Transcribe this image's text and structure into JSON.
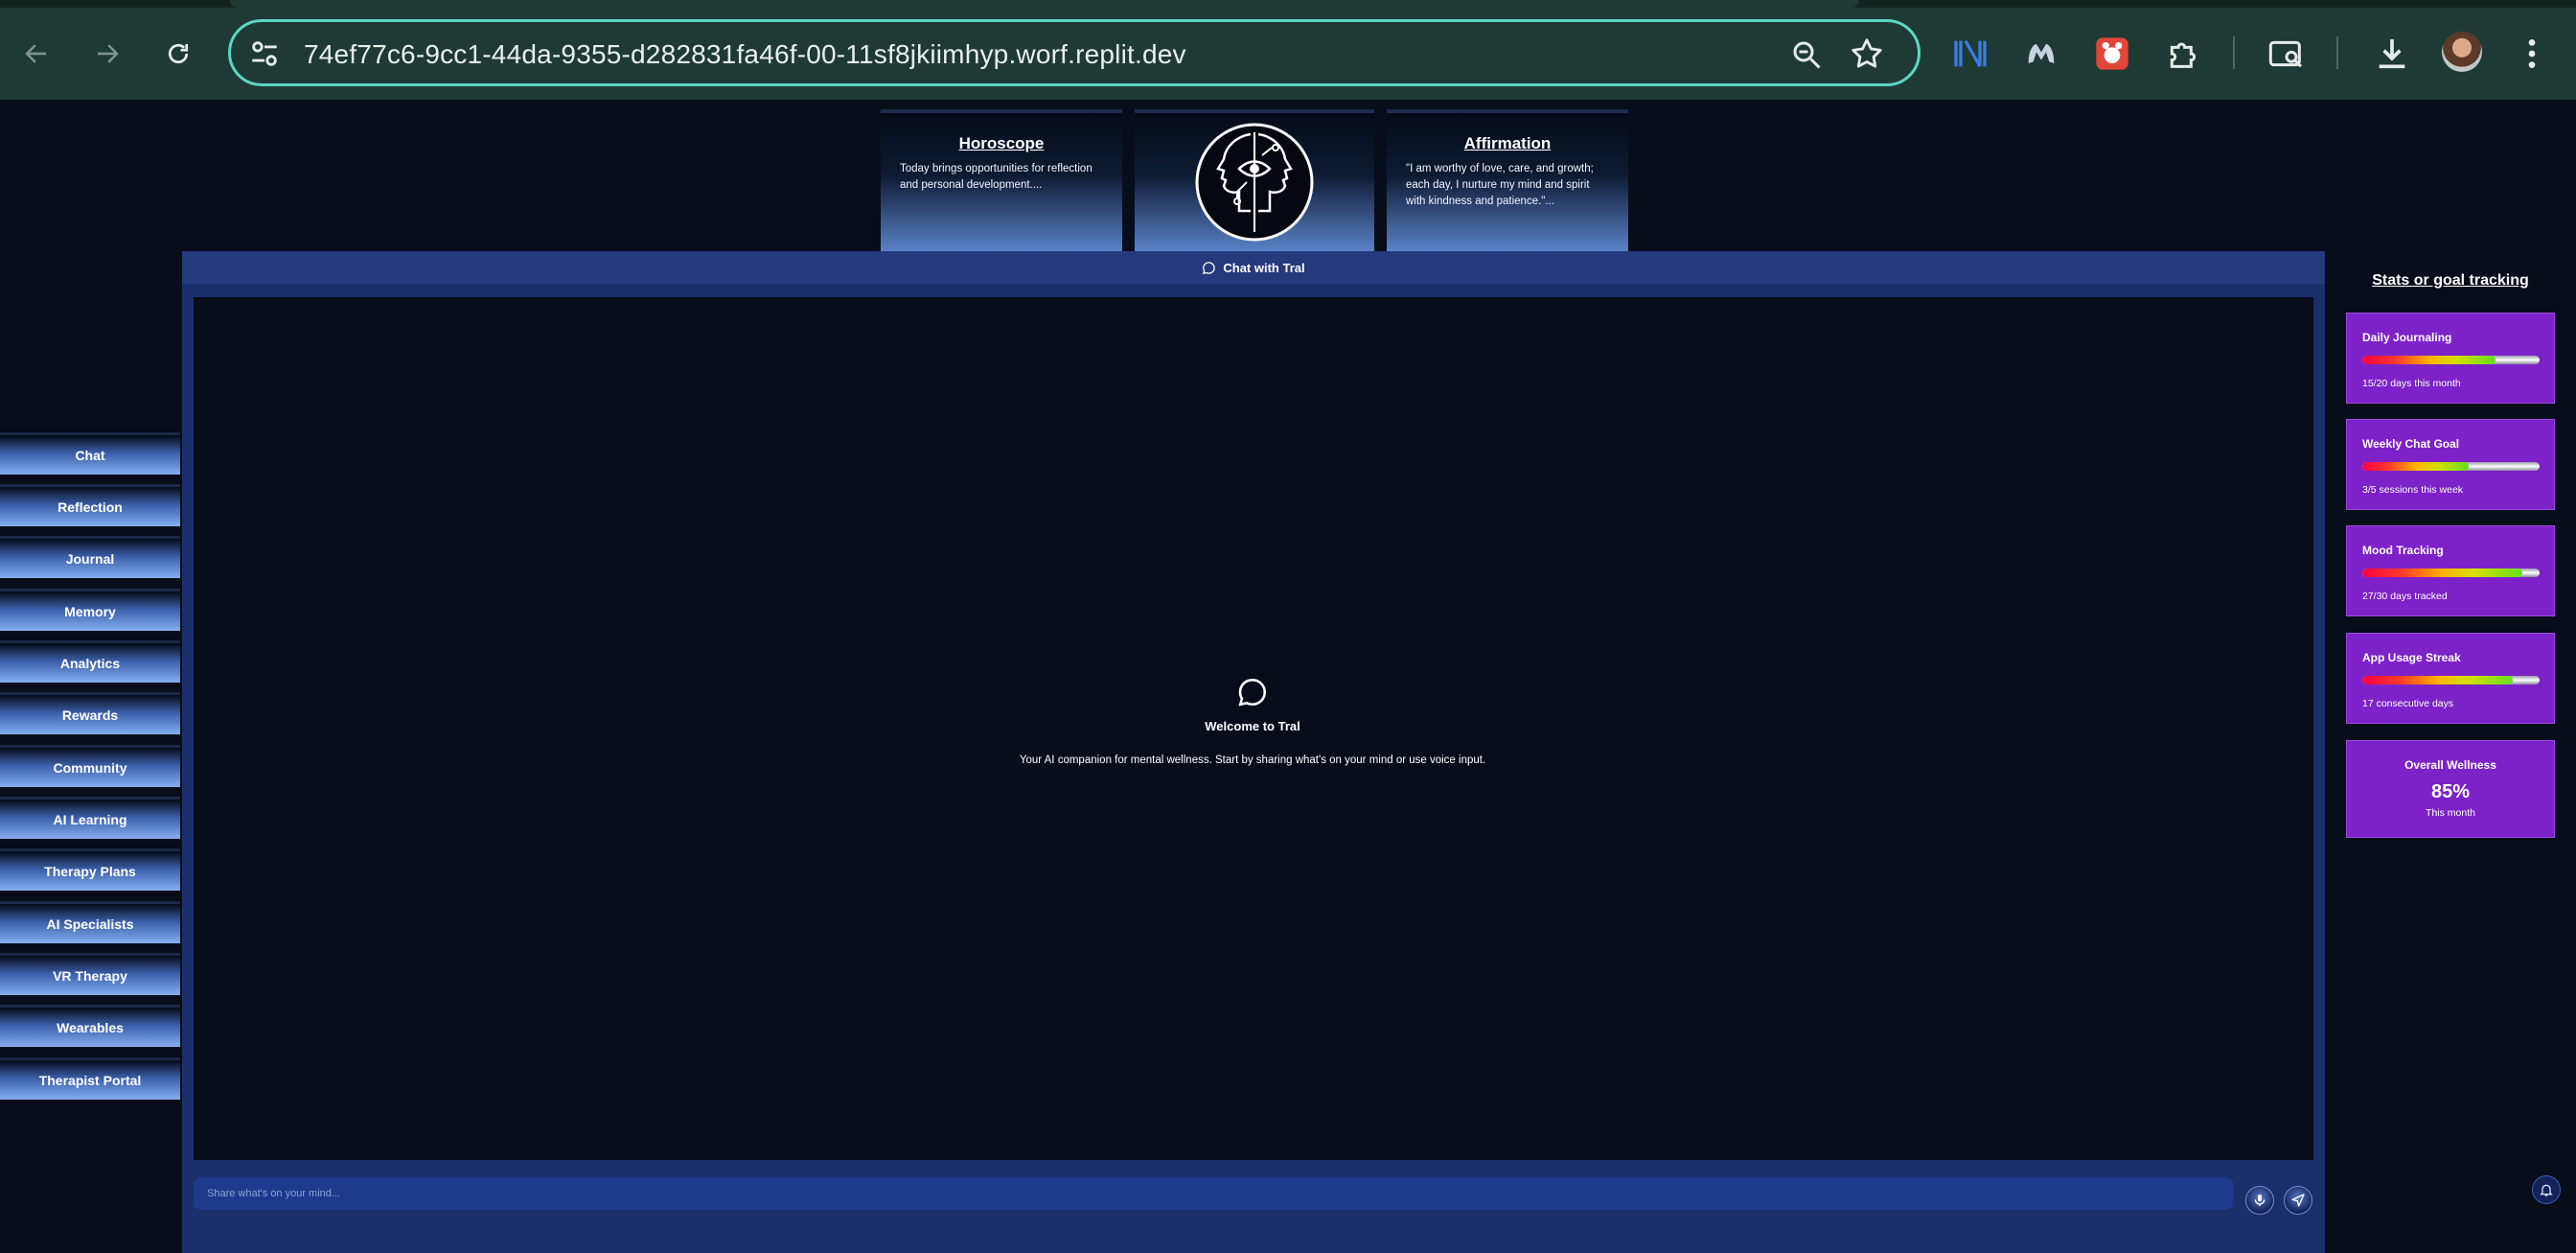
{
  "browser": {
    "url": "74ef77c6-9cc1-44da-9355-d282831fa46f-00-11sf8jkiimhyp.worf.replit.dev"
  },
  "top_cards": {
    "horoscope": {
      "title": "Horoscope",
      "text": "Today brings opportunities for reflection and personal development...."
    },
    "affirmation": {
      "title": "Affirmation",
      "text": "\"I am worthy of love, care, and growth; each day, I nurture my mind and spirit with kindness and patience.\"..."
    }
  },
  "chat": {
    "header_label": "Chat with Tral",
    "welcome_title": "Welcome to Tral",
    "welcome_text": "Your AI companion for mental wellness. Start by sharing what's on your mind or use voice input.",
    "input_placeholder": "Share what's on your mind..."
  },
  "sidebar": {
    "items": [
      {
        "label": "Chat"
      },
      {
        "label": "Reflection"
      },
      {
        "label": "Journal"
      },
      {
        "label": "Memory"
      },
      {
        "label": "Analytics"
      },
      {
        "label": "Rewards"
      },
      {
        "label": "Community"
      },
      {
        "label": "AI Learning"
      },
      {
        "label": "Therapy Plans"
      },
      {
        "label": "AI Specialists"
      },
      {
        "label": "VR Therapy"
      },
      {
        "label": "Wearables"
      },
      {
        "label": "Therapist Portal"
      }
    ]
  },
  "stats": {
    "title": "Stats or goal tracking",
    "items": [
      {
        "title": "Daily Journaling",
        "subtitle": "15/20 days this month",
        "progress": 0.75
      },
      {
        "title": "Weekly Chat Goal",
        "subtitle": "3/5 sessions this week",
        "progress": 0.6
      },
      {
        "title": "Mood Tracking",
        "subtitle": "27/30 days tracked",
        "progress": 0.9
      },
      {
        "title": "App Usage Streak",
        "subtitle": "17 consecutive days",
        "progress": 0.85
      }
    ],
    "overall": {
      "title": "Overall Wellness",
      "value": "85%",
      "subtitle": "This month"
    }
  },
  "colors": {
    "omnibox_border": "#5ed5c2",
    "chrome_bg": "#1e3a34",
    "page_bg": "#080d1a",
    "chat_header": "#253a7c",
    "stat_card": "#7d22c8"
  },
  "icons": {
    "back": "arrow-left-icon",
    "forward": "arrow-right-icon",
    "reload": "reload-icon",
    "site_settings": "tune-icon",
    "zoom": "zoom-icon",
    "bookmark": "star-icon",
    "chat": "message-bubble-icon",
    "mic": "microphone-icon",
    "send": "send-icon",
    "notifications": "bell-icon"
  }
}
